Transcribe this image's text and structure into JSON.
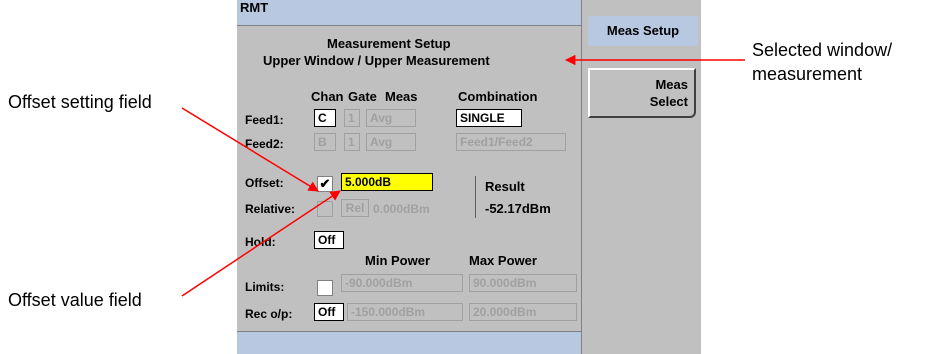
{
  "status_top": "RMT",
  "softkeys": {
    "title": "Meas Setup",
    "meas_select_line1": "Meas",
    "meas_select_line2": "Select"
  },
  "header": {
    "title": "Measurement Setup",
    "subtitle": "Upper Window / Upper Measurement"
  },
  "columns": {
    "chan": "Chan",
    "gate": "Gate",
    "meas": "Meas",
    "combination": "Combination"
  },
  "feed1": {
    "label": "Feed1:",
    "chan": "C",
    "gate": "1",
    "meas": "Avg",
    "combination": "SINGLE"
  },
  "feed2": {
    "label": "Feed2:",
    "chan": "B",
    "gate": "1",
    "meas": "Avg",
    "combination": "Feed1/Feed2"
  },
  "offset": {
    "label": "Offset:",
    "checked_mark": "✔",
    "value": "5.000dB"
  },
  "relative": {
    "label": "Relative:",
    "button": "Rel",
    "value": "0.000dBm"
  },
  "result": {
    "label": "Result",
    "value": "-52.17dBm"
  },
  "hold": {
    "label": "Hold:",
    "value": "Off"
  },
  "limits": {
    "label": "Limits:",
    "min_header": "Min Power",
    "max_header": "Max Power",
    "min": "-90.000dBm",
    "max": "90.000dBm"
  },
  "rec_op": {
    "label": "Rec o/p:",
    "value": "Off",
    "min": "-150.000dBm",
    "max": "20.000dBm"
  },
  "callouts": {
    "offset_setting": "Offset setting field",
    "offset_value": "Offset value field",
    "selected_window_line1": "Selected window/",
    "selected_window_line2": "measurement"
  },
  "colors": {
    "highlight": "#ffff00",
    "status_bar": "#b8c8e0",
    "panel": "#c0c0c0",
    "arrow": "#ff0000"
  }
}
